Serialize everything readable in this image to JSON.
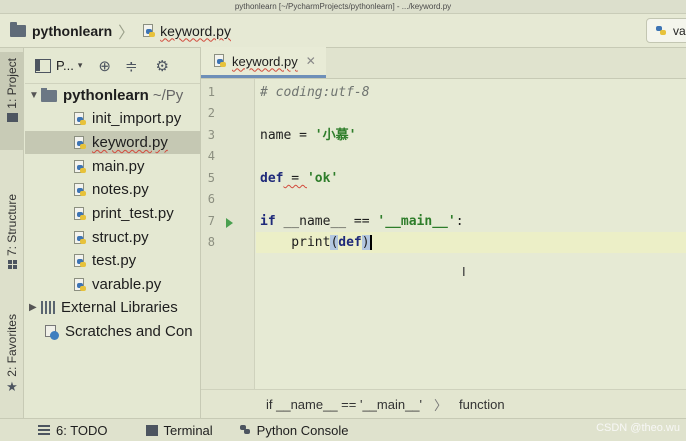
{
  "window": {
    "title": "pythonlearn [~/PycharmProjects/pythonlearn] - .../keyword.py"
  },
  "navbar": {
    "project": "pythonlearn",
    "file": "keyword.py",
    "run_config": "va"
  },
  "left_tabs": {
    "project": "1: Project",
    "structure": "7: Structure",
    "favorites": "2: Favorites"
  },
  "project_panel": {
    "view": "P...",
    "root": {
      "name": "pythonlearn",
      "path": "~/Py"
    },
    "files": [
      "init_import.py",
      "keyword.py",
      "main.py",
      "notes.py",
      "print_test.py",
      "struct.py",
      "test.py",
      "varable.py"
    ],
    "selected_file": "keyword.py",
    "external_libraries": "External Libraries",
    "scratches": "Scratches and Con"
  },
  "editor": {
    "tab_label": "keyword.py",
    "line_numbers": [
      "1",
      "2",
      "3",
      "4",
      "5",
      "6",
      "7",
      "8"
    ],
    "current_line": 8,
    "code": {
      "l1": "# coding:utf-8",
      "l3_var": "name",
      "l3_eq": " = ",
      "l3_str": "'小慕'",
      "l5_kw": "def",
      "l5_eq": " = ",
      "l5_str": "'ok'",
      "l7_kw": "if",
      "l7_mid": " __name__ == ",
      "l7_str": "'__main__'",
      "l7_end": ":",
      "l8_indent": "    print",
      "l8_open": "(",
      "l8_kw": "def",
      "l8_close": ")"
    },
    "breadcrumb": {
      "condition": "if __name__ == '__main__'",
      "scope": "function"
    }
  },
  "bottom_bar": {
    "todo": "6: TODO",
    "terminal": "Terminal",
    "console": "Python Console"
  },
  "watermark": "CSDN @theo.wu"
}
